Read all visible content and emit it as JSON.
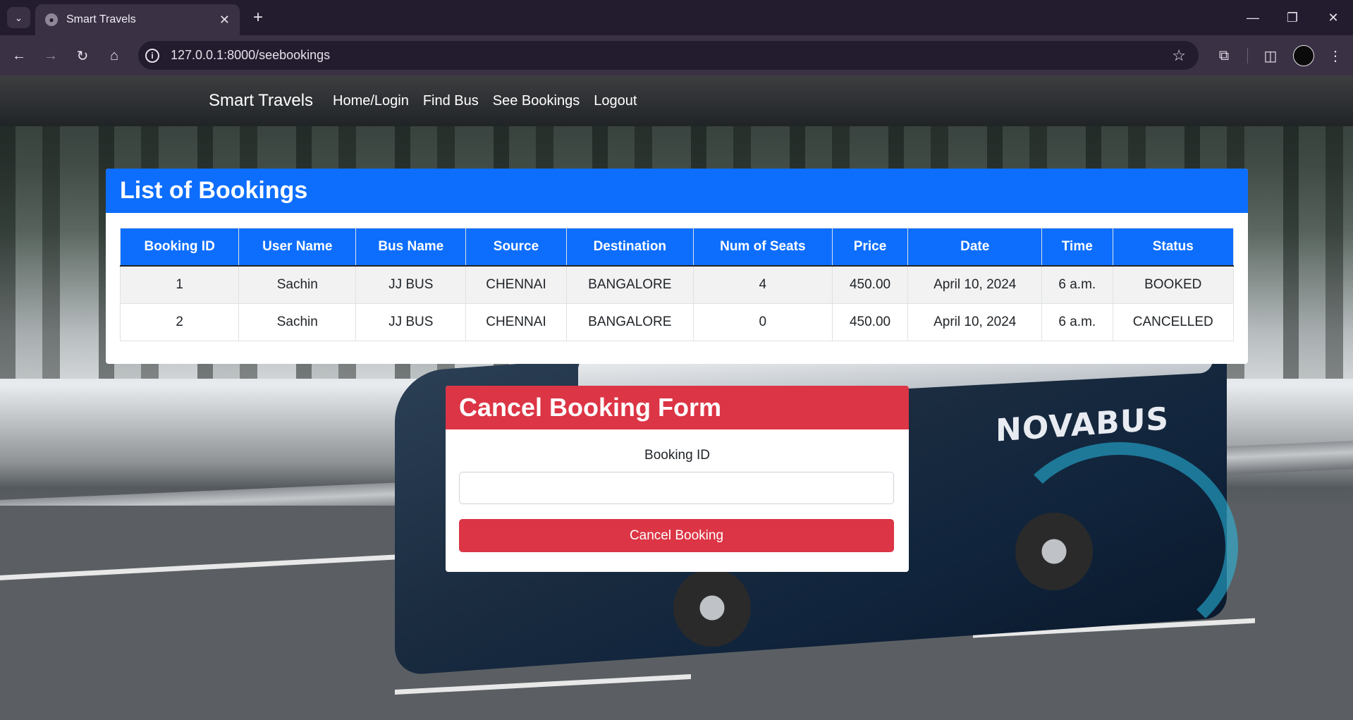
{
  "browser": {
    "tab_title": "Smart Travels",
    "url": "127.0.0.1:8000/seebookings",
    "icons": [
      "tab-dropdown-icon",
      "globe-icon",
      "close-icon",
      "plus-icon",
      "minimize-icon",
      "restore-icon",
      "window-close-icon",
      "back-icon",
      "forward-icon",
      "reload-icon",
      "home-icon",
      "info-icon",
      "star-icon",
      "extensions-icon",
      "sidepanel-icon",
      "profile-icon",
      "menu-icon"
    ]
  },
  "navbar": {
    "brand": "Smart Travels",
    "links": [
      "Home/Login",
      "Find Bus",
      "See Bookings",
      "Logout"
    ]
  },
  "bookings": {
    "title": "List of Bookings",
    "columns": [
      "Booking ID",
      "User Name",
      "Bus Name",
      "Source",
      "Destination",
      "Num of Seats",
      "Price",
      "Date",
      "Time",
      "Status"
    ],
    "rows": [
      [
        "1",
        "Sachin",
        "JJ BUS",
        "CHENNAI",
        "BANGALORE",
        "4",
        "450.00",
        "April 10, 2024",
        "6 a.m.",
        "BOOKED"
      ],
      [
        "2",
        "Sachin",
        "JJ BUS",
        "CHENNAI",
        "BANGALORE",
        "0",
        "450.00",
        "April 10, 2024",
        "6 a.m.",
        "CANCELLED"
      ]
    ]
  },
  "cancel_form": {
    "title": "Cancel Booking Form",
    "field_label": "Booking ID",
    "field_value": "",
    "button_label": "Cancel Booking"
  },
  "background": {
    "bus_logo": "NOVABUS"
  },
  "colors": {
    "primary": "#0d6efd",
    "danger": "#dc3545",
    "navbar": "#212529"
  }
}
